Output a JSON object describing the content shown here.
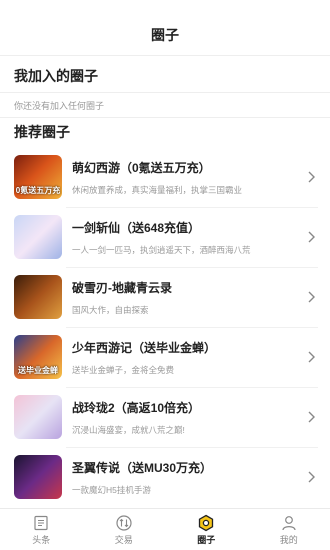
{
  "header": {
    "title": "圈子"
  },
  "joined": {
    "title": "我加入的圈子",
    "empty_text": "你还没有加入任何圈子"
  },
  "recommended": {
    "title": "推荐圈子",
    "items": [
      {
        "name": "萌幻西游（0氪送五万充）",
        "desc": "休闲放置养成，真实海量福利，执掌三国霸业",
        "thumb_text": "0氪送五万充"
      },
      {
        "name": "一剑斩仙（送648充值）",
        "desc": "一人一剑一匹马，执剑逍遥天下，酒醉西海八荒",
        "thumb_text": ""
      },
      {
        "name": "破雪刃-地藏青云录",
        "desc": "国风大作，自由探索",
        "thumb_text": ""
      },
      {
        "name": "少年西游记（送毕业金蝉）",
        "desc": "送毕业金蝉子，金将全免费",
        "thumb_text": "送毕业金蝉"
      },
      {
        "name": "战玲珑2（高返10倍充）",
        "desc": "沉浸山海盛宴，成就八荒之巅!",
        "thumb_text": ""
      },
      {
        "name": "圣翼传说（送MU30万充）",
        "desc": "一款魔幻H5挂机手游",
        "thumb_text": ""
      }
    ]
  },
  "tabbar": {
    "tabs": [
      {
        "label": "头条",
        "icon": "article-icon"
      },
      {
        "label": "交易",
        "icon": "exchange-icon"
      },
      {
        "label": "圈子",
        "icon": "circle-icon"
      },
      {
        "label": "我的",
        "icon": "profile-icon"
      }
    ],
    "active": "圈子"
  },
  "colors": {
    "accent": "#f5c518",
    "text": "#222222",
    "muted": "#9a9a9a"
  }
}
